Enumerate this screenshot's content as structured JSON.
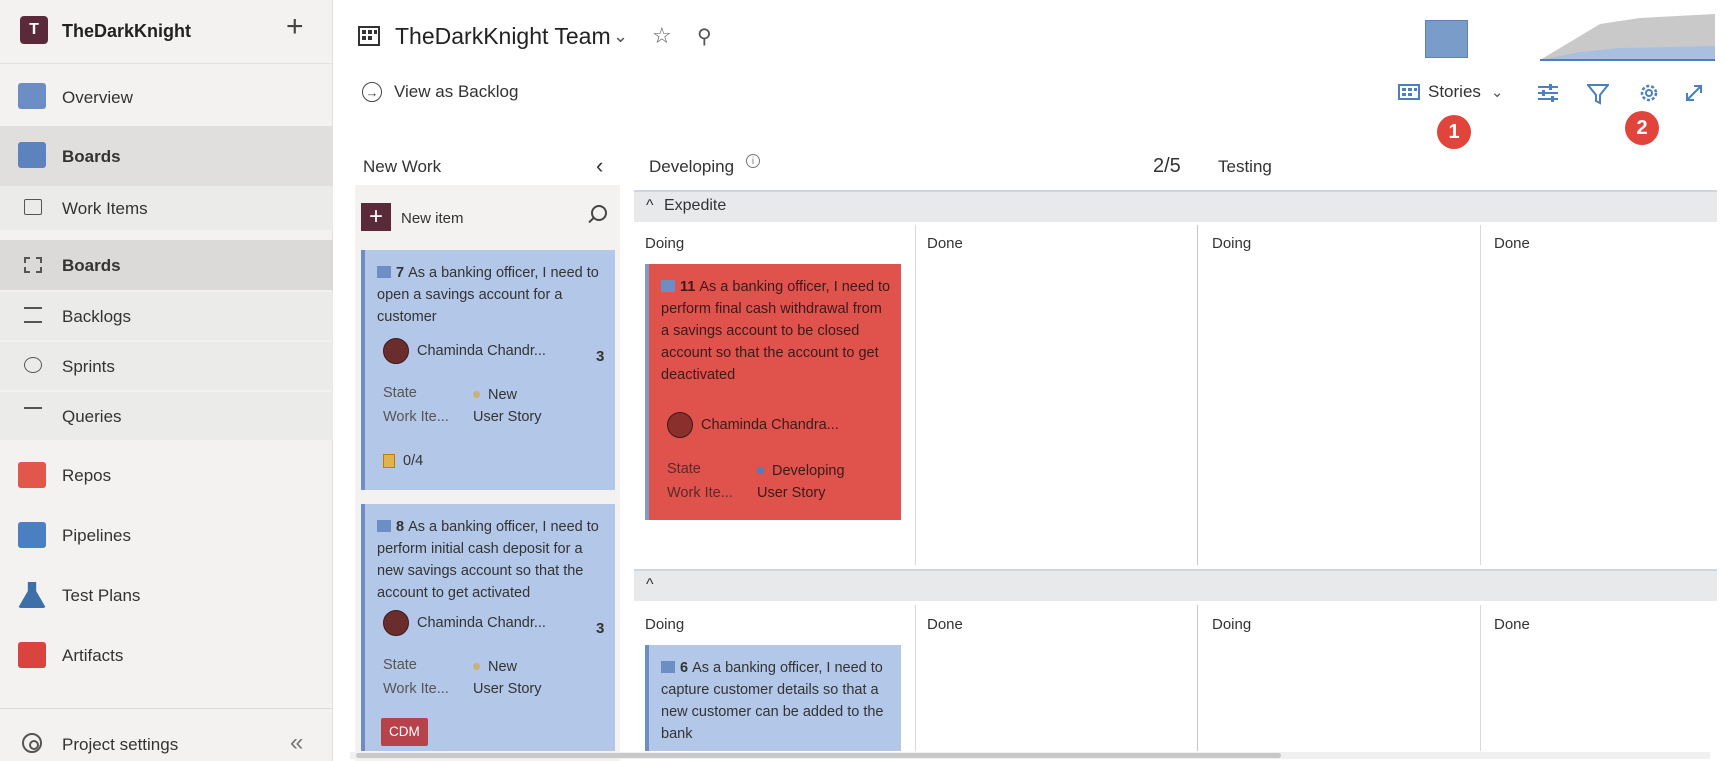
{
  "sidebar": {
    "org_initial": "T",
    "org_name": "TheDarkKnight",
    "add_glyph": "+",
    "items": [
      {
        "label": "Overview",
        "icon": "overview-icon"
      },
      {
        "label": "Boards",
        "icon": "boards-icon"
      },
      {
        "label": "Work Items",
        "icon": "work-items-icon"
      },
      {
        "label": "Boards",
        "icon": "board-grid-icon"
      },
      {
        "label": "Backlogs",
        "icon": "backlogs-icon"
      },
      {
        "label": "Sprints",
        "icon": "sprints-icon"
      },
      {
        "label": "Queries",
        "icon": "queries-icon"
      },
      {
        "label": "Repos",
        "icon": "repos-icon"
      },
      {
        "label": "Pipelines",
        "icon": "pipelines-icon"
      },
      {
        "label": "Test Plans",
        "icon": "test-plans-icon"
      },
      {
        "label": "Artifacts",
        "icon": "artifacts-icon"
      }
    ],
    "project_settings": "Project settings",
    "collapse_glyph": "«"
  },
  "header": {
    "team_title": "TheDarkKnight Team",
    "chevron": "⌄",
    "star": "☆",
    "members": "⚲"
  },
  "toolbar": {
    "view_as_backlog": "View as Backlog",
    "backlog_level": "Stories",
    "markers": [
      "1",
      "2"
    ]
  },
  "board": {
    "new_work": {
      "title": "New Work",
      "collapse_glyph": "‹",
      "new_item_label": "New item"
    },
    "columns": [
      {
        "title": "Developing",
        "wip": "2/5"
      },
      {
        "title": "Testing"
      }
    ],
    "swimlanes": [
      {
        "title": "Expedite",
        "sub_columns": [
          "Doing",
          "Done",
          "Doing",
          "Done"
        ]
      },
      {
        "title": "",
        "sub_columns": [
          "Doing",
          "Done",
          "Doing",
          "Done"
        ]
      }
    ],
    "field_labels": {
      "state": "State",
      "work_item_type": "Work Ite..."
    },
    "cards": [
      {
        "id": "7",
        "title": "As a banking officer, I need to open a savings account for a customer",
        "assignee": "Chaminda Chandr...",
        "effort": "3",
        "state": "New",
        "type": "User Story",
        "tasks": "0/4"
      },
      {
        "id": "8",
        "title": "As a banking officer, I need to perform initial cash deposit for a new savings account so that the account to get activated",
        "assignee": "Chaminda Chandr...",
        "effort": "3",
        "state": "New",
        "type": "User Story",
        "tag": "CDM"
      },
      {
        "id": "11",
        "title": "As a banking officer, I need to perform final cash withdrawal from a savings account to be closed account so that the account to get deactivated",
        "assignee": "Chaminda Chandra...",
        "state": "Developing",
        "type": "User Story"
      },
      {
        "id": "6",
        "title": "As a banking officer, I need to capture customer details so that a new customer can be added to the bank"
      }
    ]
  },
  "colors": {
    "card_blue": "#b3c7e8",
    "card_red": "#e0534d",
    "accent_maroon": "#5b2a3a",
    "marker_red": "#e0443a"
  }
}
